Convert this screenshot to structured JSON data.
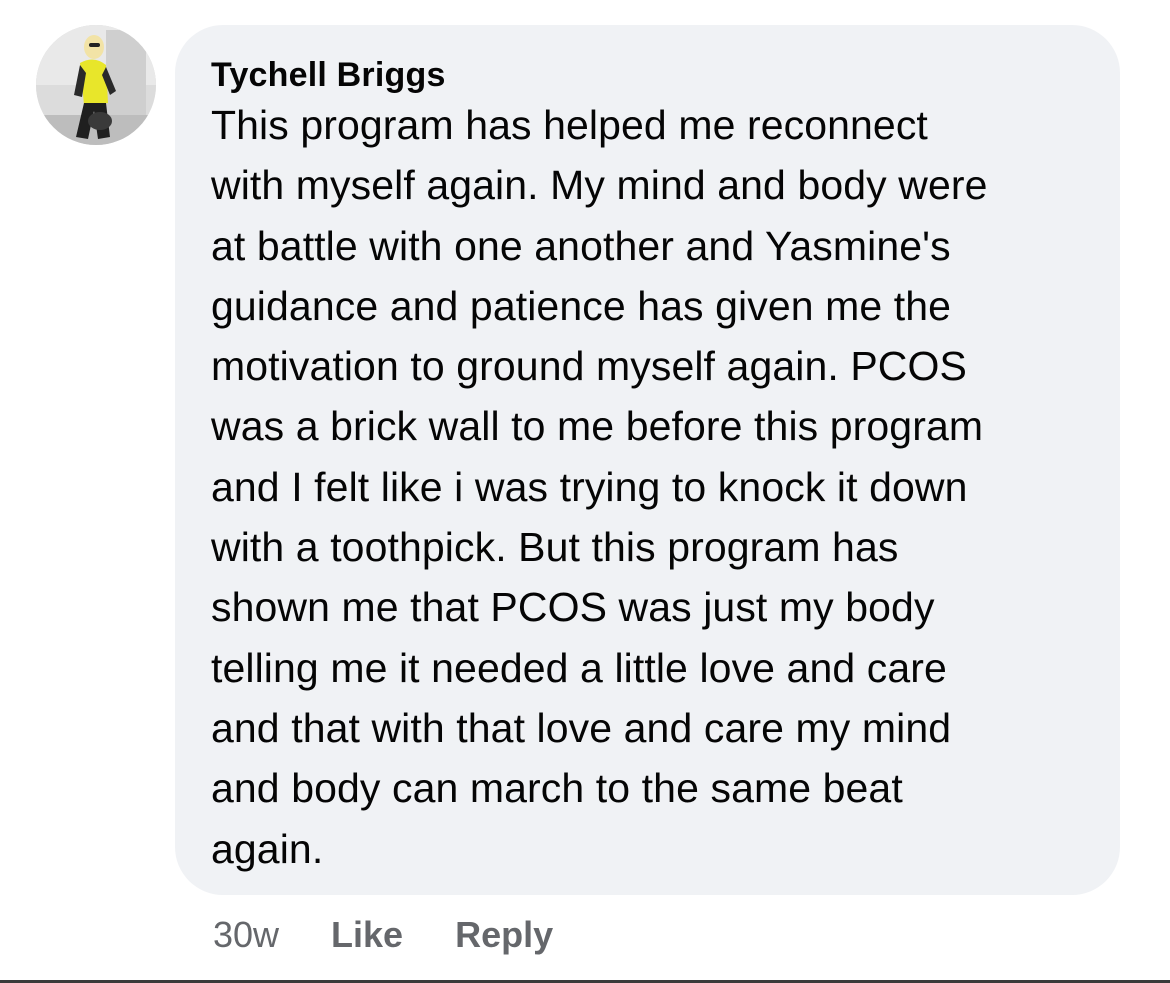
{
  "comment": {
    "author": "Tychell Briggs",
    "lines": [
      "This program has helped me reconnect",
      "with myself again. My mind and body were",
      "at battle with one another and Yasmine's",
      "guidance and patience has given me the",
      "motivation to ground myself again. PCOS",
      "was a brick wall to me before this program",
      "and I felt like i was trying to knock it down",
      "with a toothpick. But this program has",
      "shown me that PCOS was just my body",
      "telling me it needed a little love and care",
      "and that with that love and care my mind",
      "and body can march to the same beat",
      "again."
    ],
    "timestamp": "30w",
    "like_label": "Like",
    "reply_label": "Reply"
  },
  "colors": {
    "bubble_bg": "#f0f2f5",
    "text": "#050505",
    "meta_text": "#65676b"
  },
  "icons": {
    "avatar": "profile-photo"
  }
}
